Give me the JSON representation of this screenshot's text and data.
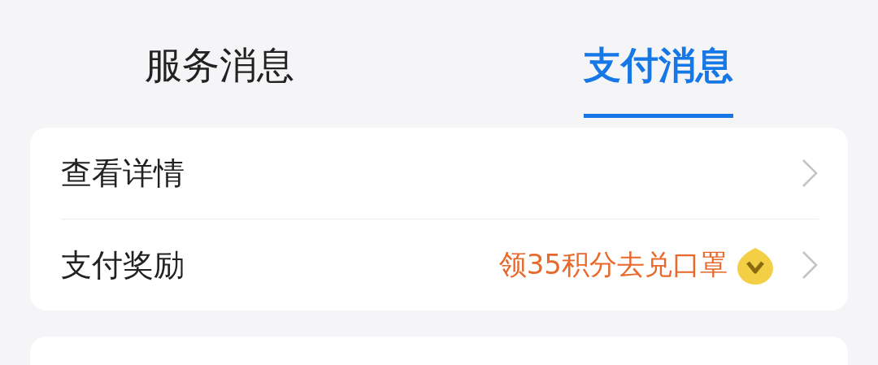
{
  "tabs": [
    {
      "label": "服务消息",
      "selected": false
    },
    {
      "label": "支付消息",
      "selected": true
    }
  ],
  "rows": [
    {
      "label": "查看详情"
    },
    {
      "label": "支付奖励",
      "value": "领35积分去兑口罩"
    }
  ]
}
